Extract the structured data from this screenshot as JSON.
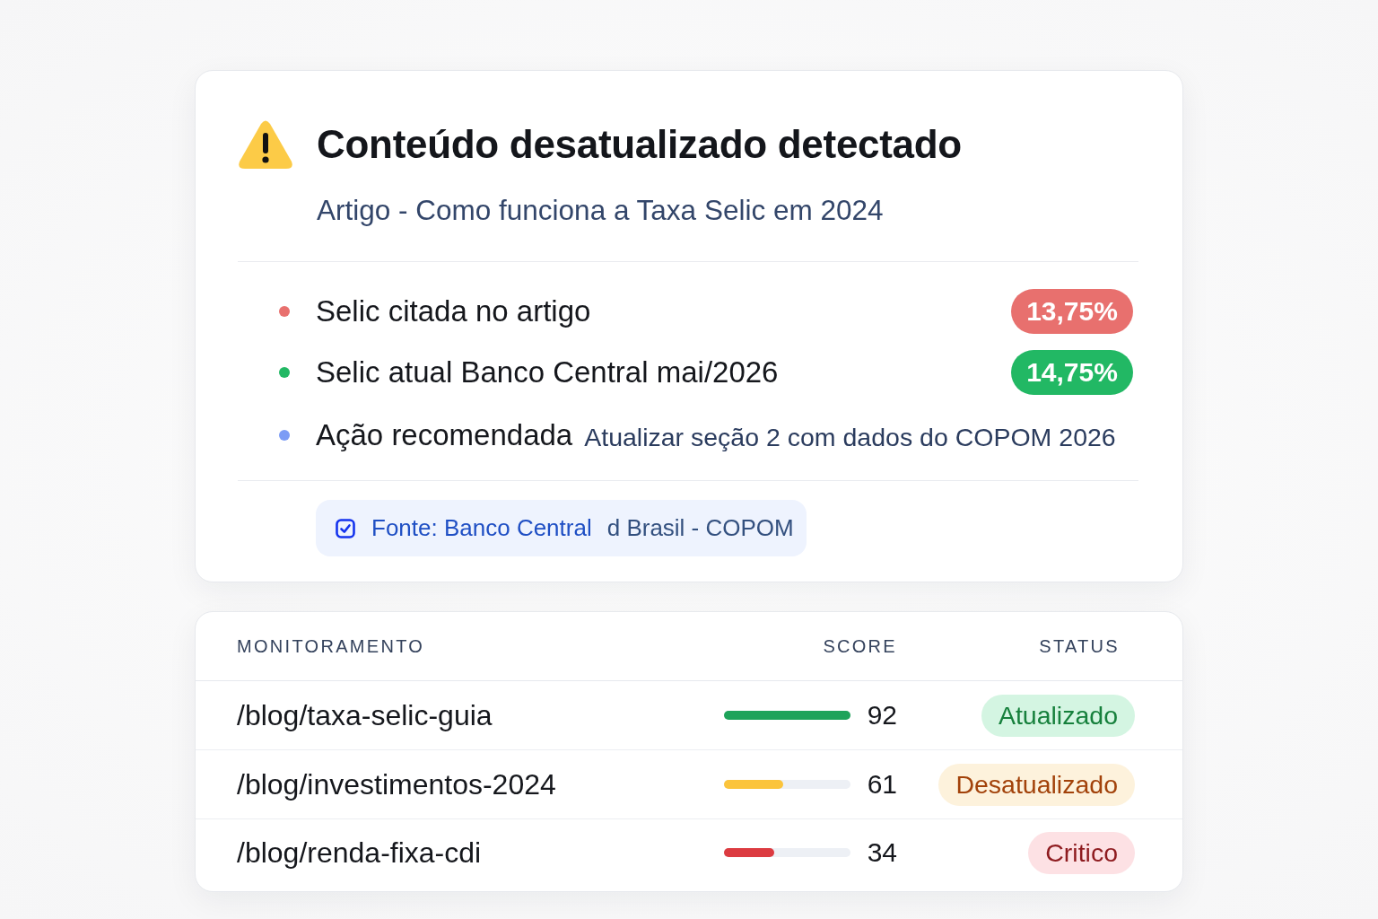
{
  "alert": {
    "title": "Conteúdo desatualizado detectado",
    "subtitle": "Artigo - Como funciona a Taxa Selic em 2024",
    "facts": [
      {
        "kind": "pill",
        "label": "Selic citada no artigo",
        "value": "13,75%",
        "color": "#e8706e"
      },
      {
        "kind": "pill",
        "label": "Selic atual Banco Central mai/2026",
        "value": "14,75%",
        "color": "#22b864"
      },
      {
        "kind": "note",
        "label": "Ação recomendada",
        "value": "Atualizar seção 2 com dados do COPOM 2026",
        "color": "#7c9cf5"
      }
    ],
    "source": {
      "label": "Fonte: Banco Central",
      "detail": "d Brasil - COPOM"
    }
  },
  "monitor": {
    "columns": [
      "MONITORAMENTO",
      "SCORE",
      "STATUS"
    ],
    "rows": [
      {
        "kind": "ok",
        "path": "/blog/taxa-selic-guia",
        "score": "92",
        "level": 1,
        "color": "#1ea35a",
        "status": "Atualizado"
      },
      {
        "kind": "warn",
        "path": "/blog/investimentos-2024",
        "score": "61",
        "level": 0.47,
        "color": "#fbc43c",
        "status": "Desatualizado"
      },
      {
        "kind": "critical",
        "path": "/blog/renda-fixa-cdi",
        "score": "34",
        "level": 0.4,
        "color": "#dc3b41",
        "status": "Critico"
      }
    ]
  }
}
